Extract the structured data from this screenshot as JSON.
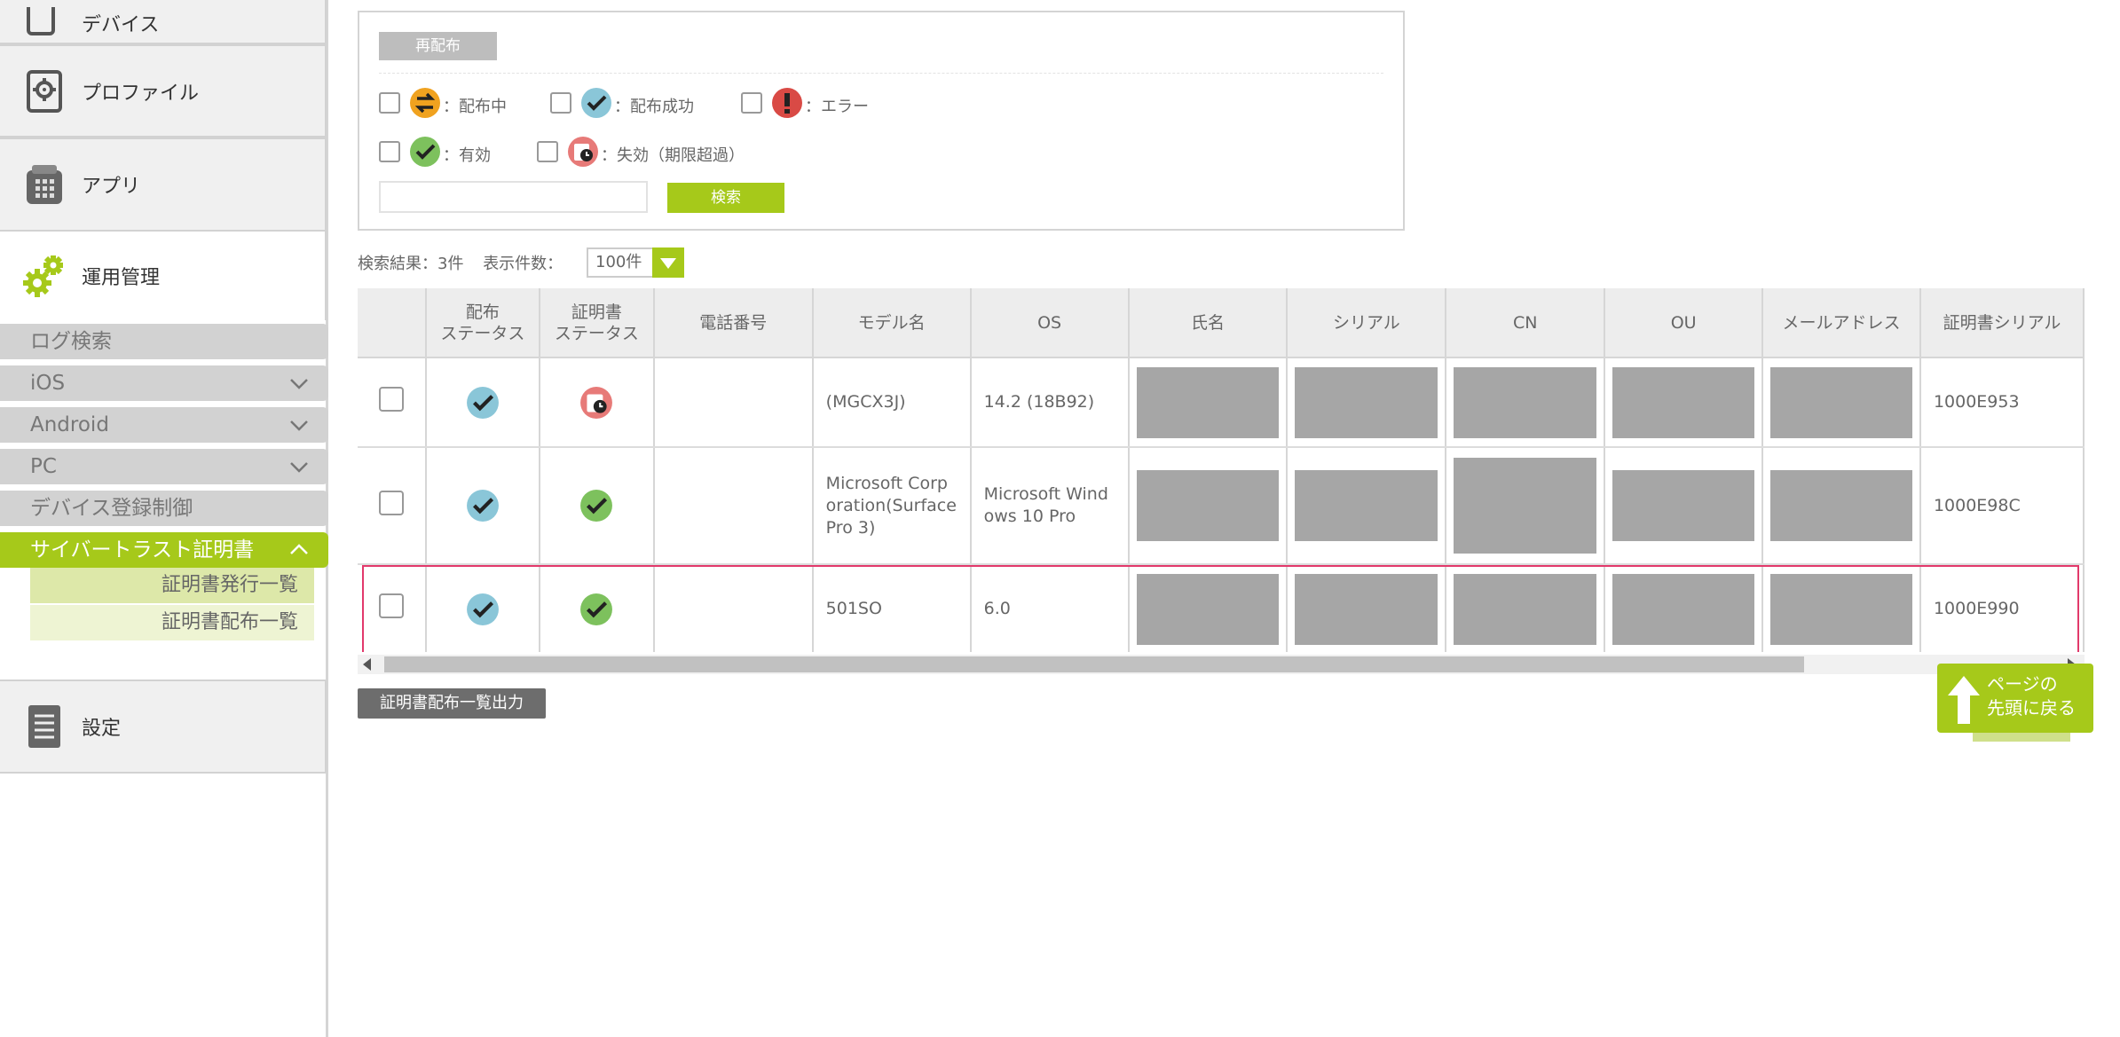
{
  "sidebar": {
    "top_cut_label": "デバイス",
    "profile_label": "プロファイル",
    "app_label": "アプリ",
    "ops_label": "運用管理",
    "settings_label": "設定",
    "sub_items": [
      {
        "label": "ログ検索"
      },
      {
        "label": "iOS"
      },
      {
        "label": "Android"
      },
      {
        "label": "PC"
      },
      {
        "label": "デバイス登録制御"
      },
      {
        "label": "サイバートラスト証明書"
      }
    ],
    "cert_children": [
      {
        "label": "証明書発行一覧"
      },
      {
        "label": "証明書配布一覧"
      }
    ]
  },
  "search_panel": {
    "redistribute_label": "再配布",
    "legend": [
      {
        "label": "：配布中",
        "icon": "arrows-swap-icon",
        "color": "#f0a21f"
      },
      {
        "label": "：配布成功",
        "icon": "check-icon",
        "color": "#8ac6d8"
      },
      {
        "label": "：エラー",
        "icon": "exclamation-icon",
        "color": "#d94a45"
      },
      {
        "label": "：有効",
        "icon": "check-icon",
        "color": "#7dc15d"
      },
      {
        "label": "：失効（期限超過）",
        "icon": "expired-icon",
        "color": "#e77a78"
      }
    ],
    "search_value": "",
    "search_label": "検索"
  },
  "results": {
    "count_text": "検索結果：3件",
    "per_page_label": "表示件数：",
    "per_page_value": "100件"
  },
  "table": {
    "headers": [
      "",
      "配布\nステータス",
      "証明書\nステータス",
      "電話番号",
      "モデル名",
      "OS",
      "氏名",
      "シリアル",
      "CN",
      "OU",
      "メールアドレス",
      "証明書シリアル"
    ],
    "rows": [
      {
        "dist_status": "success",
        "cert_status": "expired",
        "phone": "",
        "model": "(MGCX3J)",
        "os": "14.2 (18B92)",
        "cert_serial": "1000E953"
      },
      {
        "dist_status": "success",
        "cert_status": "valid",
        "phone": "",
        "model": "Microsoft Corporation(Surface Pro 3)",
        "os": "Microsoft Windows 10 Pro",
        "cert_serial": "1000E98C"
      },
      {
        "dist_status": "success",
        "cert_status": "valid",
        "phone": "",
        "model": "501SO",
        "os": "6.0",
        "cert_serial": "1000E990"
      }
    ]
  },
  "export_label": "証明書配布一覧出力",
  "back_to_top_label": "ページの\n先頭に戻る",
  "colors": {
    "accent": "#a6c91a",
    "highlight_border": "#e2396b",
    "redaction": "#a6a6a6"
  }
}
